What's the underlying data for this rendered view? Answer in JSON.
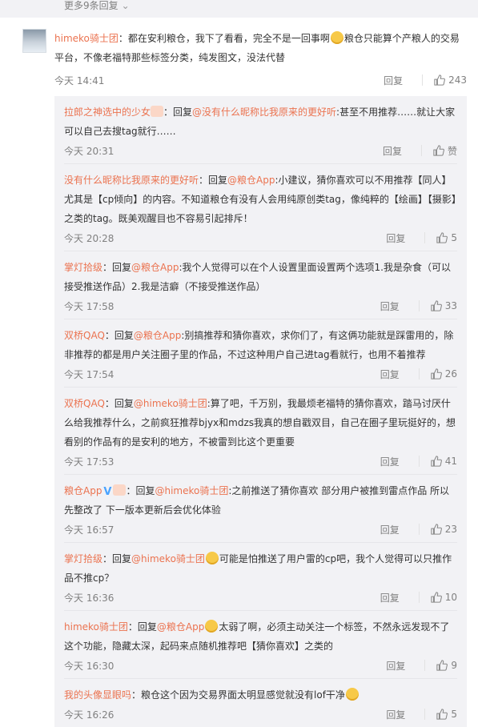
{
  "top": {
    "more_label": "更多9条回复",
    "chevron": "chevron-down-icon"
  },
  "main_comment": {
    "user": "himeko骑士团",
    "text_a": "：都在安利粮仓，我下了看看，完全不是一回事啊",
    "text_b": "粮仓只能算个产粮人的交易平台，不像老福特那些标签分类，纯发图文，没法代替",
    "time": "今天 14:41",
    "reply_label": "回复",
    "likes": "243"
  },
  "replies": [
    {
      "user": "拉郎之神选中的少女",
      "badge": "fire-badge",
      "reply_word": "：回复",
      "mention": "@没有什么昵称比我原来的更好听",
      "text": ":甚至不用推荐……就让大家可以自己去搜tag就行……",
      "time": "今天 20:31",
      "reply_label": "回复",
      "likes": "赞"
    },
    {
      "user": "没有什么昵称比我原来的更好听",
      "reply_word": "：回复",
      "mention": "@粮仓App",
      "text": ":小建议，猜你喜欢可以不用推荐【同人】尤其是【cp倾向】的内容。不知道粮仓有没有人会用纯原创类tag，像纯粹的【绘画】【摄影】之类的tag。既美观醒目也不容易引起排斥！",
      "time": "今天 20:28",
      "reply_label": "回复",
      "likes": "5"
    },
    {
      "user": "掌灯拾级",
      "reply_word": "：回复",
      "mention": "@粮仓App",
      "text": ":我个人觉得可以在个人设置里面设置两个选项1.我是杂食（可以接受推送作品）2.我是洁癖（不接受推送作品）",
      "time": "今天 17:58",
      "reply_label": "回复",
      "likes": "33"
    },
    {
      "user": "双桥QAQ",
      "reply_word": "：回复",
      "mention": "@粮仓App",
      "text": ":别搞推荐和猜你喜欢，求你们了，有这俩功能就是踩雷用的，除非推荐的都是用户关注圈子里的作品，不过这种用户自己进tag看就行，也用不着推荐",
      "time": "今天 17:54",
      "reply_label": "回复",
      "likes": "26"
    },
    {
      "user": "双桥QAQ",
      "reply_word": "：回复",
      "mention": "@himeko骑士团",
      "text": ":算了吧，千万别，我最烦老福特的猜你喜欢，踏马讨厌什么给我推荐什么，之前疯狂推荐bjyx和mdzs我真的想自戳双目，自己在圈子里玩挺好的，想看别的作品有的是安利的地方，不被雷到比这个更重要",
      "time": "今天 17:53",
      "reply_label": "回复",
      "likes": "41"
    },
    {
      "user": "粮仓App",
      "verified": "V",
      "badge": "fire-badge",
      "reply_word": "：回复",
      "mention": "@himeko骑士团",
      "text": ":之前推送了猜你喜欢 部分用户被推到雷点作品 所以先整改了 下一版本更新后会优化体验",
      "time": "今天 16:57",
      "reply_label": "回复",
      "likes": "23"
    },
    {
      "user": "掌灯拾级",
      "reply_word": "：回复",
      "mention": "@himeko骑士团",
      "emoji": true,
      "text": "可能是怕推送了用户雷的cp吧，我个人觉得可以只推作品不推cp？",
      "time": "今天 16:36",
      "reply_label": "回复",
      "likes": "10"
    },
    {
      "user": "himeko骑士团",
      "reply_word": "：回复",
      "mention": "@粮仓App",
      "emoji": true,
      "text": "太弱了啊，必须主动关注一个标签，不然永远发现不了这个功能，隐藏太深，起码来点随机推荐吧【猜你喜欢】之类的",
      "time": "今天 16:30",
      "reply_label": "回复",
      "likes": "9"
    },
    {
      "user": "我的头像显眼吗",
      "reply_word": "：",
      "mention": "",
      "text": "粮仓这个因为交易界面太明显感觉就没有lof干净",
      "emoji_end": true,
      "time": "今天 16:26",
      "reply_label": "回复",
      "likes": "5"
    }
  ]
}
